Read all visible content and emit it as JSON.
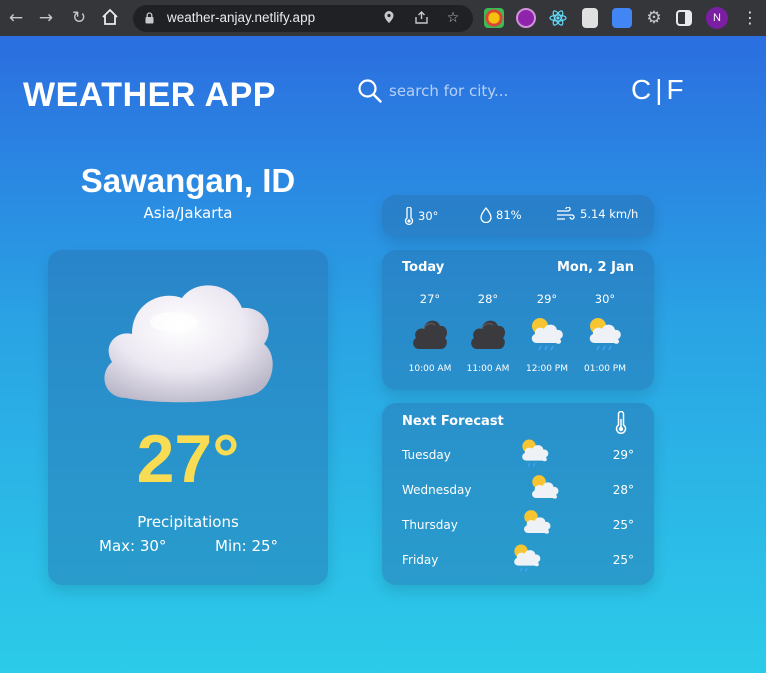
{
  "browser": {
    "url": "weather-anjay.netlify.app",
    "profile_initial": "N"
  },
  "header": {
    "logo": "WEATHER APP",
    "search_placeholder": "search for city...",
    "unit_c": "C",
    "unit_sep": "|",
    "unit_f": "F"
  },
  "location": {
    "city": "Sawangan, ID",
    "timezone": "Asia/Jakarta"
  },
  "current": {
    "icon": "cloud-icon",
    "temp": "27°",
    "condition": "Precipitations",
    "max": "Max: 30°",
    "min": "Min: 25°"
  },
  "stats": {
    "feels_like": "30°",
    "humidity": "81%",
    "wind": "5.14 km/h"
  },
  "today": {
    "label": "Today",
    "date": "Mon, 2 Jan",
    "hours": [
      {
        "temp": "27°",
        "time": "10:00 AM",
        "icon": "dark-cloud-icon"
      },
      {
        "temp": "28°",
        "time": "11:00 AM",
        "icon": "dark-cloud-icon"
      },
      {
        "temp": "29°",
        "time": "12:00 PM",
        "icon": "sun-rain-cloud-icon"
      },
      {
        "temp": "30°",
        "time": "01:00 PM",
        "icon": "sun-rain-cloud-icon"
      }
    ]
  },
  "forecast": {
    "label": "Next Forecast",
    "days": [
      {
        "day": "Tuesday",
        "temp": "29°",
        "icon": "sun-rain-cloud-icon"
      },
      {
        "day": "Wednesday",
        "temp": "28°",
        "icon": "sun-cloud-icon"
      },
      {
        "day": "Thursday",
        "temp": "25°",
        "icon": "sun-cloud-icon"
      },
      {
        "day": "Friday",
        "temp": "25°",
        "icon": "sun-rain-cloud-icon"
      }
    ]
  },
  "colors": {
    "accent_temp": "#f8dc54",
    "bg_top": "#2b6ee0",
    "bg_bottom": "#2ccbe9"
  }
}
